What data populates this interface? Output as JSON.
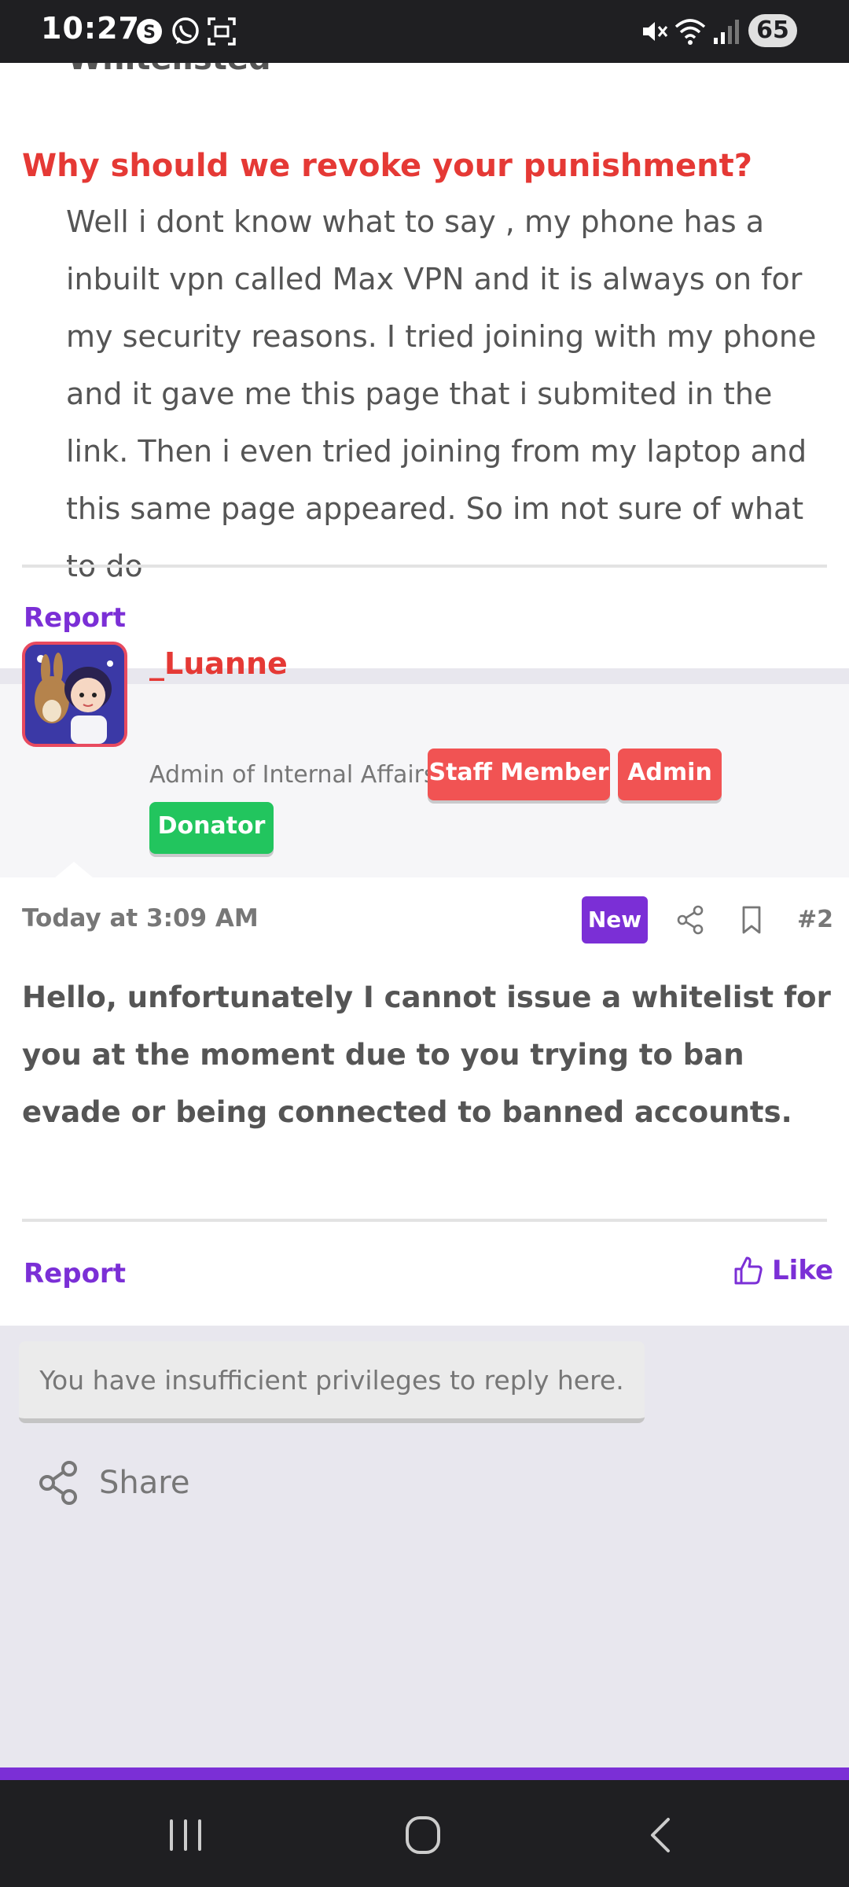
{
  "status_bar": {
    "time": "10:27",
    "battery": "65"
  },
  "post1": {
    "cut_text": "Whitelisted",
    "question": "Why should we revoke your punishment?",
    "answer": "Well i dont know what to say , my phone has a inbuilt vpn called Max VPN and it is always on for my security reasons. I tried joining with my phone and it gave me this page that i submited in the link. Then i even tried joining from my laptop and this same page appeared. So im not sure of what to do",
    "report_label": "Report"
  },
  "author": {
    "name": "_Luanne",
    "title": "Admin of Internal Affairs",
    "badges": {
      "staff": "Staff Member",
      "admin": "Admin",
      "donator": "Donator"
    }
  },
  "post2": {
    "date": "Today at 3:09 AM",
    "new_label": "New",
    "post_number": "#2",
    "message": "Hello, unfortunately I cannot issue a whitelist for you at the moment due to you trying to ban evade or being connected to banned accounts.",
    "report_label": "Report",
    "like_label": "Like"
  },
  "thread_footer": {
    "no_reply_text": "You have insufficient privileges to reply here.",
    "share_label": "Share"
  },
  "colors": {
    "accent": "#7b2fd6",
    "staff_red": "#f15353",
    "donator_green": "#22c55e",
    "question_red": "#e53935"
  },
  "icons": {
    "share": "share-icon",
    "bookmark": "bookmark-icon",
    "like": "thumbs-up-icon"
  }
}
